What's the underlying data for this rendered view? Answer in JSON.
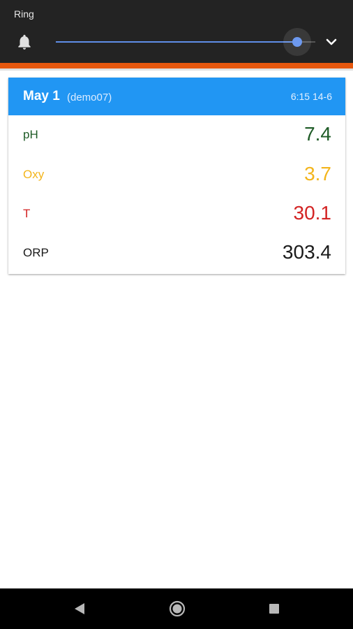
{
  "ring_panel": {
    "label": "Ring",
    "volume_fraction": 0.93,
    "icons": {
      "bell": "bell-icon",
      "expand": "chevron-down-icon"
    }
  },
  "card": {
    "title": "May 1",
    "subtitle": "(demo07)",
    "time": "6:15 14-6",
    "rows": [
      {
        "label": "pH",
        "value": "7.4",
        "color": "#1e5b26"
      },
      {
        "label": "Oxy",
        "value": "3.7",
        "color": "#f3b51c"
      },
      {
        "label": "T",
        "value": "30.1",
        "color": "#d32323"
      },
      {
        "label": "ORP",
        "value": "303.4",
        "color": "#1a1a1a"
      }
    ]
  },
  "colors": {
    "header_blue": "#2196f3",
    "accent_orange": "#e5570e",
    "panel_dark": "#232323",
    "slider_blue": "#5f8ee8"
  },
  "nav_bar": {
    "icons": [
      "back-icon",
      "home-icon",
      "recents-icon"
    ]
  }
}
